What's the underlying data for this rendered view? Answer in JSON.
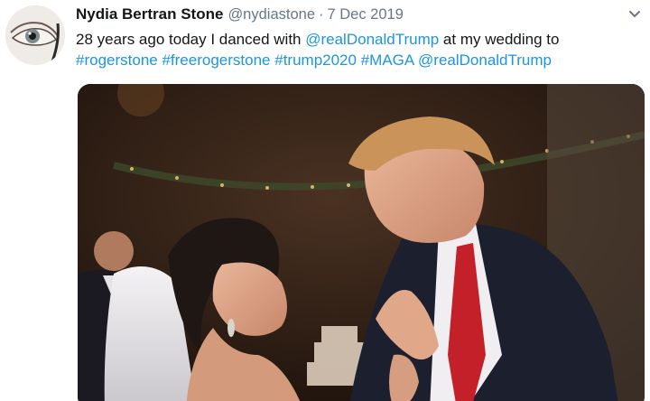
{
  "tweet": {
    "display_name": "Nydia Bertran Stone",
    "handle": "@nydiastone",
    "separator": "·",
    "date": "7 Dec 2019",
    "text": {
      "line1_prefix": "28 years ago today I danced with ",
      "mention_1": "@realDonaldTrump",
      "line1_suffix": " at my wedding to",
      "hashtags": [
        "#rogerstone",
        "#freerogerstone",
        "#trump2020",
        "#MAGA"
      ],
      "mention_2": "@realDonaldTrump"
    }
  },
  "colors": {
    "name": "#14171a",
    "secondary": "#657786",
    "link": "#1b95e0"
  },
  "icons": {
    "caret": "chevron-down-icon",
    "avatar": "eye-avatar"
  }
}
